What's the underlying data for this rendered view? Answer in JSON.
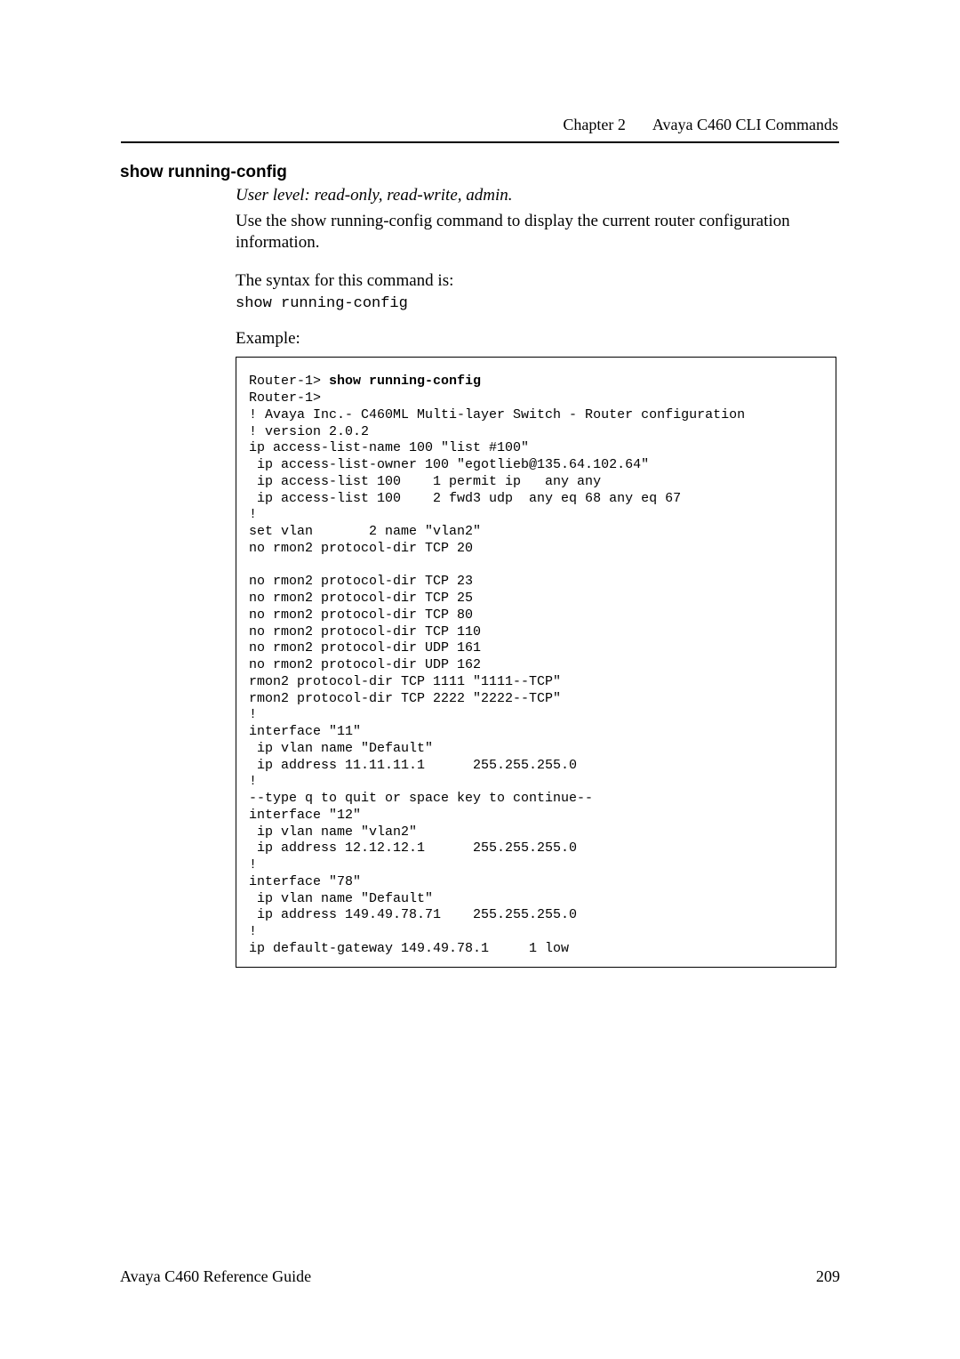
{
  "header": {
    "chapter": "Chapter 2",
    "title": "Avaya C460 CLI Commands"
  },
  "section": {
    "title": "show running-config",
    "user_level": "User level: read-only, read-write, admin.",
    "description": "Use the show running-config command to display the current router configuration information.",
    "syntax_intro": "The syntax for this command is:",
    "syntax": "show running-config",
    "example_label": "Example:"
  },
  "example": {
    "prompt": "Router-1> ",
    "command": "show running-config",
    "output": "Router-1>\n! Avaya Inc.- C460ML Multi-layer Switch - Router configuration\n! version 2.0.2\nip access-list-name 100 \"list #100\"\n ip access-list-owner 100 \"egotlieb@135.64.102.64\"\n ip access-list 100    1 permit ip   any any\n ip access-list 100    2 fwd3 udp  any eq 68 any eq 67\n!\nset vlan       2 name \"vlan2\"\nno rmon2 protocol-dir TCP 20\n\nno rmon2 protocol-dir TCP 23\nno rmon2 protocol-dir TCP 25\nno rmon2 protocol-dir TCP 80\nno rmon2 protocol-dir TCP 110\nno rmon2 protocol-dir UDP 161\nno rmon2 protocol-dir UDP 162\nrmon2 protocol-dir TCP 1111 \"1111--TCP\"\nrmon2 protocol-dir TCP 2222 \"2222--TCP\"\n!\ninterface \"11\"\n ip vlan name \"Default\"\n ip address 11.11.11.1      255.255.255.0\n!\n--type q to quit or space key to continue--\ninterface \"12\"\n ip vlan name \"vlan2\"\n ip address 12.12.12.1      255.255.255.0\n!\ninterface \"78\"\n ip vlan name \"Default\"\n ip address 149.49.78.71    255.255.255.0\n!\nip default-gateway 149.49.78.1     1 low"
  },
  "footer": {
    "left": "Avaya C460 Reference Guide",
    "right": "209"
  }
}
